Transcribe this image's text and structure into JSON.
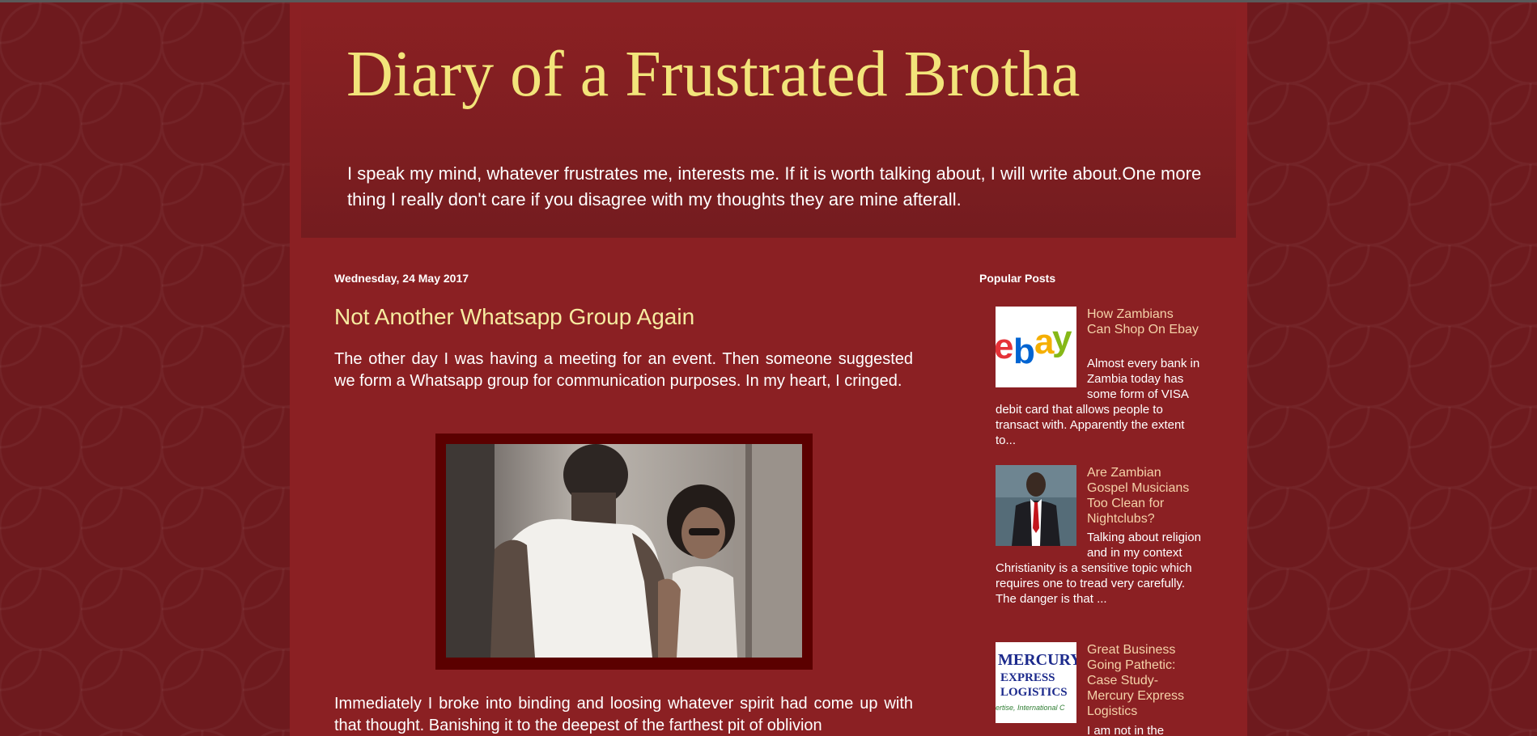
{
  "blog": {
    "title": "Diary of a Frustrated Brotha",
    "description": "I speak my mind, whatever frustrates me, interests me. If it is worth talking about, I will write about.One more thing I really don't care if you disagree with my thoughts they are mine afterall."
  },
  "post": {
    "date": "Wednesday, 24 May 2017",
    "title": "Not Another Whatsapp Group Again",
    "paragraph1": "The other day I was having a meeting for an event. Then someone suggested we form a Whatsapp group for communication purposes. In my heart, I cringed.",
    "paragraph2": "Immediately I broke into binding and loosing whatever spirit had come up with that thought. Banishing it to the deepest of the farthest pit of oblivion"
  },
  "sidebar": {
    "popular_title": "Popular Posts",
    "items": [
      {
        "title": "How Zambians Can Shop On Ebay",
        "snippet": "Almost every bank in Zambia today has some form of VISA debit card that allows people to transact with. Apparently the extent to...",
        "thumb_text": "ebay"
      },
      {
        "title": "Are Zambian Gospel Musicians Too Clean for Nightclubs?",
        "snippet": "Talking about religion and in my context Christianity is a sensitive topic which requires one to tread very carefully. The danger is that ..."
      },
      {
        "title": "Great Business Going Pathetic: Case Study- Mercury Express Logistics",
        "snippet": "I am not in the",
        "thumb_line1": "MERCURY",
        "thumb_line2": "EXPRESS",
        "thumb_line3": "LOGISTICS",
        "thumb_tagline": "ertise, International C"
      }
    ]
  },
  "colors": {
    "page_bg": "#6b1a1d",
    "content_bg": "#8b2023",
    "title_yellow": "#f2e47a",
    "post_title": "#f6eba0",
    "link": "#f4d2a8",
    "image_frame": "#5b0000"
  }
}
